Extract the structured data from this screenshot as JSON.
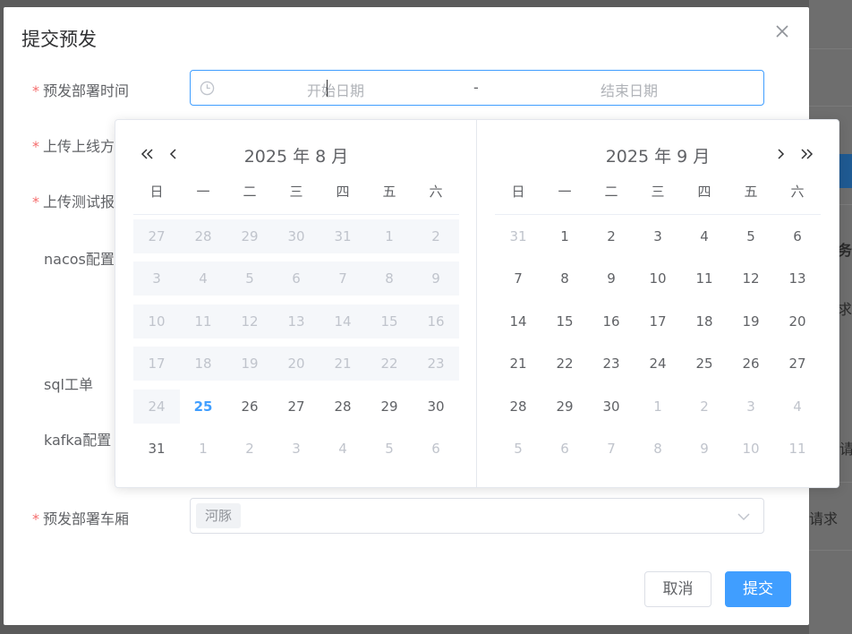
{
  "dialog": {
    "title": "提交预发",
    "cancel_label": "取消",
    "submit_label": "提交"
  },
  "form": {
    "deploy_time_label": "预发部署时间",
    "upload_online_label": "上传上线方",
    "upload_test_label": "上传测试报",
    "nacos_label": "nacos配置",
    "sql_label": "sql工单",
    "kafka_label": "kafka配置",
    "carriage_label": "预发部署车厢",
    "date_start_placeholder": "开始日期",
    "date_separator": "-",
    "date_end_placeholder": "结束日期",
    "carriage_tag": "河豚"
  },
  "background": {
    "text_1": "务",
    "text_2": "求",
    "text_3": "请",
    "text_4": "请求"
  },
  "picker": {
    "weekdays": [
      "日",
      "一",
      "二",
      "三",
      "四",
      "五",
      "六"
    ],
    "left": {
      "title": "2025 年 8 月",
      "weeks": [
        [
          {
            "d": "27",
            "s": "disabled"
          },
          {
            "d": "28",
            "s": "disabled"
          },
          {
            "d": "29",
            "s": "disabled"
          },
          {
            "d": "30",
            "s": "disabled"
          },
          {
            "d": "31",
            "s": "disabled"
          },
          {
            "d": "1",
            "s": "disabled"
          },
          {
            "d": "2",
            "s": "disabled"
          }
        ],
        [
          {
            "d": "3",
            "s": "disabled"
          },
          {
            "d": "4",
            "s": "disabled"
          },
          {
            "d": "5",
            "s": "disabled"
          },
          {
            "d": "6",
            "s": "disabled"
          },
          {
            "d": "7",
            "s": "disabled"
          },
          {
            "d": "8",
            "s": "disabled"
          },
          {
            "d": "9",
            "s": "disabled"
          }
        ],
        [
          {
            "d": "10",
            "s": "disabled"
          },
          {
            "d": "11",
            "s": "disabled"
          },
          {
            "d": "12",
            "s": "disabled"
          },
          {
            "d": "13",
            "s": "disabled"
          },
          {
            "d": "14",
            "s": "disabled"
          },
          {
            "d": "15",
            "s": "disabled"
          },
          {
            "d": "16",
            "s": "disabled"
          }
        ],
        [
          {
            "d": "17",
            "s": "disabled"
          },
          {
            "d": "18",
            "s": "disabled"
          },
          {
            "d": "19",
            "s": "disabled"
          },
          {
            "d": "20",
            "s": "disabled"
          },
          {
            "d": "21",
            "s": "disabled"
          },
          {
            "d": "22",
            "s": "disabled"
          },
          {
            "d": "23",
            "s": "disabled"
          }
        ],
        [
          {
            "d": "24",
            "s": "disabled"
          },
          {
            "d": "25",
            "s": "today"
          },
          {
            "d": "26",
            "s": ""
          },
          {
            "d": "27",
            "s": ""
          },
          {
            "d": "28",
            "s": ""
          },
          {
            "d": "29",
            "s": ""
          },
          {
            "d": "30",
            "s": ""
          }
        ],
        [
          {
            "d": "31",
            "s": ""
          },
          {
            "d": "1",
            "s": "muted"
          },
          {
            "d": "2",
            "s": "muted"
          },
          {
            "d": "3",
            "s": "muted"
          },
          {
            "d": "4",
            "s": "muted"
          },
          {
            "d": "5",
            "s": "muted"
          },
          {
            "d": "6",
            "s": "muted"
          }
        ]
      ]
    },
    "right": {
      "title": "2025 年 9 月",
      "weeks": [
        [
          {
            "d": "31",
            "s": "muted"
          },
          {
            "d": "1",
            "s": ""
          },
          {
            "d": "2",
            "s": ""
          },
          {
            "d": "3",
            "s": ""
          },
          {
            "d": "4",
            "s": ""
          },
          {
            "d": "5",
            "s": ""
          },
          {
            "d": "6",
            "s": ""
          }
        ],
        [
          {
            "d": "7",
            "s": ""
          },
          {
            "d": "8",
            "s": ""
          },
          {
            "d": "9",
            "s": ""
          },
          {
            "d": "10",
            "s": ""
          },
          {
            "d": "11",
            "s": ""
          },
          {
            "d": "12",
            "s": ""
          },
          {
            "d": "13",
            "s": ""
          }
        ],
        [
          {
            "d": "14",
            "s": ""
          },
          {
            "d": "15",
            "s": ""
          },
          {
            "d": "16",
            "s": ""
          },
          {
            "d": "17",
            "s": ""
          },
          {
            "d": "18",
            "s": ""
          },
          {
            "d": "19",
            "s": ""
          },
          {
            "d": "20",
            "s": ""
          }
        ],
        [
          {
            "d": "21",
            "s": ""
          },
          {
            "d": "22",
            "s": ""
          },
          {
            "d": "23",
            "s": ""
          },
          {
            "d": "24",
            "s": ""
          },
          {
            "d": "25",
            "s": ""
          },
          {
            "d": "26",
            "s": ""
          },
          {
            "d": "27",
            "s": ""
          }
        ],
        [
          {
            "d": "28",
            "s": ""
          },
          {
            "d": "29",
            "s": ""
          },
          {
            "d": "30",
            "s": ""
          },
          {
            "d": "1",
            "s": "muted"
          },
          {
            "d": "2",
            "s": "muted"
          },
          {
            "d": "3",
            "s": "muted"
          },
          {
            "d": "4",
            "s": "muted"
          }
        ],
        [
          {
            "d": "5",
            "s": "muted"
          },
          {
            "d": "6",
            "s": "muted"
          },
          {
            "d": "7",
            "s": "muted"
          },
          {
            "d": "8",
            "s": "muted"
          },
          {
            "d": "9",
            "s": "muted"
          },
          {
            "d": "10",
            "s": "muted"
          },
          {
            "d": "11",
            "s": "muted"
          }
        ]
      ]
    }
  },
  "colors": {
    "primary": "#409eff",
    "required": "#f56c6c",
    "disabled_bg": "#f5f7fa"
  }
}
